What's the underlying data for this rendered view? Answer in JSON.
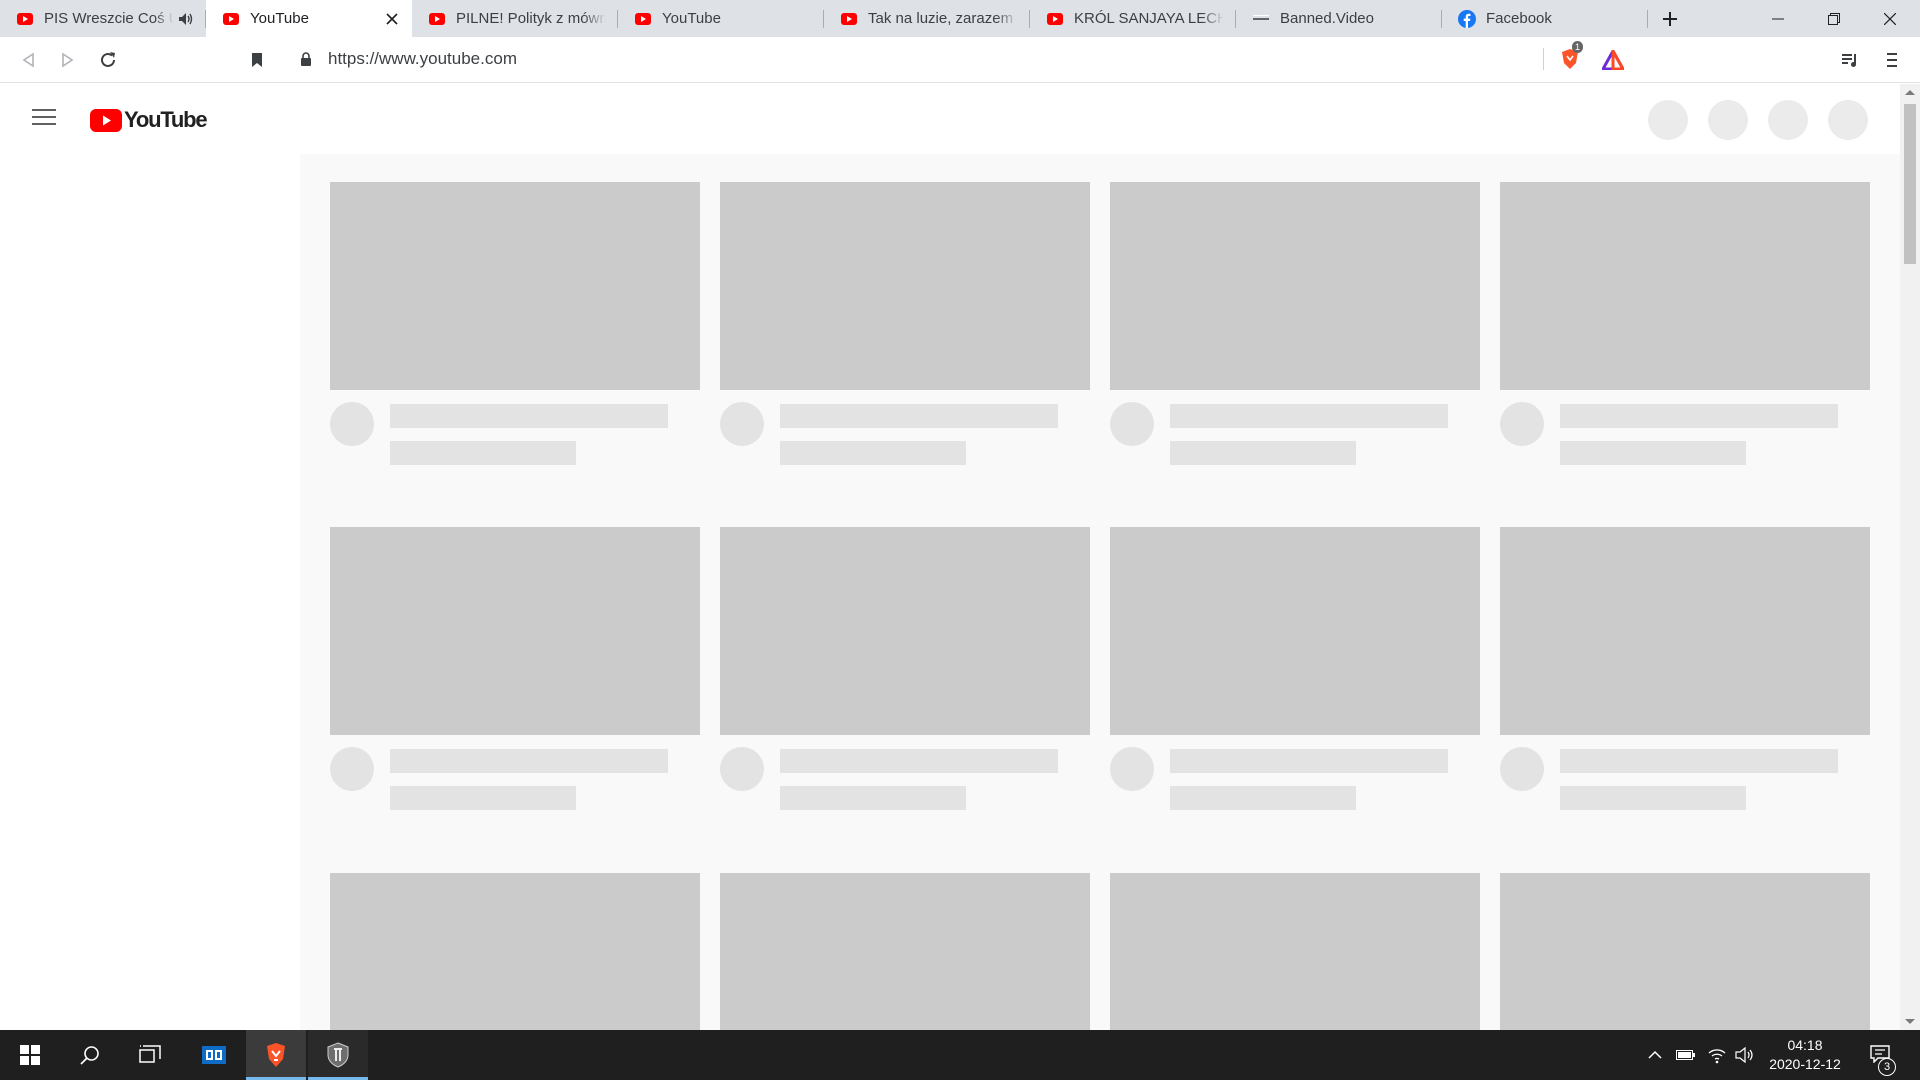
{
  "browser": {
    "tabs": [
      {
        "title": "PIS Wreszcie Coś Ugryzło",
        "favicon": "youtube-favicon",
        "active": false,
        "audio": true
      },
      {
        "title": "YouTube",
        "favicon": "youtube-favicon",
        "active": true,
        "audio": false
      },
      {
        "title": "PILNE! Polityk z mównicy",
        "favicon": "youtube-favicon",
        "active": false,
        "audio": false
      },
      {
        "title": "YouTube",
        "favicon": "youtube-favicon",
        "active": false,
        "audio": false
      },
      {
        "title": "Tak na luzie, zarazem po",
        "favicon": "youtube-favicon",
        "active": false,
        "audio": false
      },
      {
        "title": "KRÓL SANJAYA LECHJI O",
        "favicon": "youtube-favicon",
        "active": false,
        "audio": false
      },
      {
        "title": "Banned.Video",
        "favicon": "banned-video-favicon",
        "active": false,
        "audio": false
      },
      {
        "title": "Facebook",
        "favicon": "facebook-favicon",
        "active": false,
        "audio": false
      }
    ],
    "url": "https://www.youtube.com",
    "shields_badge": "1"
  },
  "youtube": {
    "logo_text": "YouTube",
    "brand_color": "#ff0000",
    "skeleton_rows": 3,
    "skeleton_columns": 4
  },
  "taskbar": {
    "time": "04:18",
    "date": "2020-12-12",
    "notification_count": "3"
  }
}
